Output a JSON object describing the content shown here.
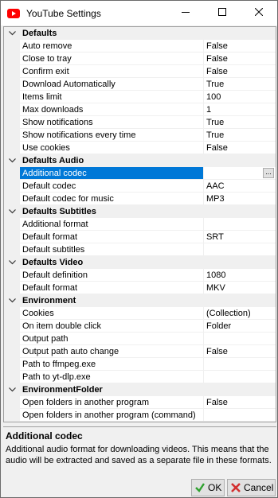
{
  "window": {
    "title": "YouTube Settings",
    "icon": "youtube-icon",
    "controls": [
      "minimize-icon",
      "maximize-icon",
      "close-icon"
    ]
  },
  "grid": {
    "categories": [
      {
        "label": "Defaults",
        "properties": [
          {
            "name": "Auto remove",
            "value": "False"
          },
          {
            "name": "Close to tray",
            "value": "False"
          },
          {
            "name": "Confirm exit",
            "value": "False"
          },
          {
            "name": "Download Automatically",
            "value": "True"
          },
          {
            "name": "Items limit",
            "value": "100"
          },
          {
            "name": "Max downloads",
            "value": "1"
          },
          {
            "name": "Show notifications",
            "value": "True"
          },
          {
            "name": "Show notifications every time",
            "value": "True"
          },
          {
            "name": "Use cookies",
            "value": "False"
          }
        ]
      },
      {
        "label": "Defaults Audio",
        "properties": [
          {
            "name": "Additional codec",
            "value": "",
            "selected": true,
            "button": "..."
          },
          {
            "name": "Default codec",
            "value": "AAC"
          },
          {
            "name": "Default codec for music",
            "value": "MP3"
          }
        ]
      },
      {
        "label": "Defaults Subtitles",
        "properties": [
          {
            "name": "Additional format",
            "value": ""
          },
          {
            "name": "Default format",
            "value": "SRT"
          },
          {
            "name": "Default subtitles",
            "value": ""
          }
        ]
      },
      {
        "label": "Defaults Video",
        "properties": [
          {
            "name": "Default definition",
            "value": "1080"
          },
          {
            "name": "Default format",
            "value": "MKV"
          }
        ]
      },
      {
        "label": "Environment",
        "properties": [
          {
            "name": "Cookies",
            "value": "(Collection)"
          },
          {
            "name": "On item double click",
            "value": "Folder"
          },
          {
            "name": "Output path",
            "value": ""
          },
          {
            "name": "Output path auto change",
            "value": "False"
          },
          {
            "name": "Path to ffmpeg.exe",
            "value": ""
          },
          {
            "name": "Path to yt-dlp.exe",
            "value": ""
          }
        ]
      },
      {
        "label": "EnvironmentFolder",
        "properties": [
          {
            "name": "Open folders in another program",
            "value": "False"
          },
          {
            "name": "Open folders in another program (command)",
            "value": ""
          }
        ]
      }
    ]
  },
  "description": {
    "title": "Additional codec",
    "text": "Additional audio format for downloading videos. This means that the audio will be extracted and saved as a separate file in these formats."
  },
  "buttons": {
    "ok_label": "OK",
    "cancel_label": "Cancel"
  },
  "colors": {
    "selection": "#0078d7",
    "youtube_red": "#ff0000",
    "ok_green": "#2ea12e",
    "cancel_red": "#d32f2f"
  }
}
